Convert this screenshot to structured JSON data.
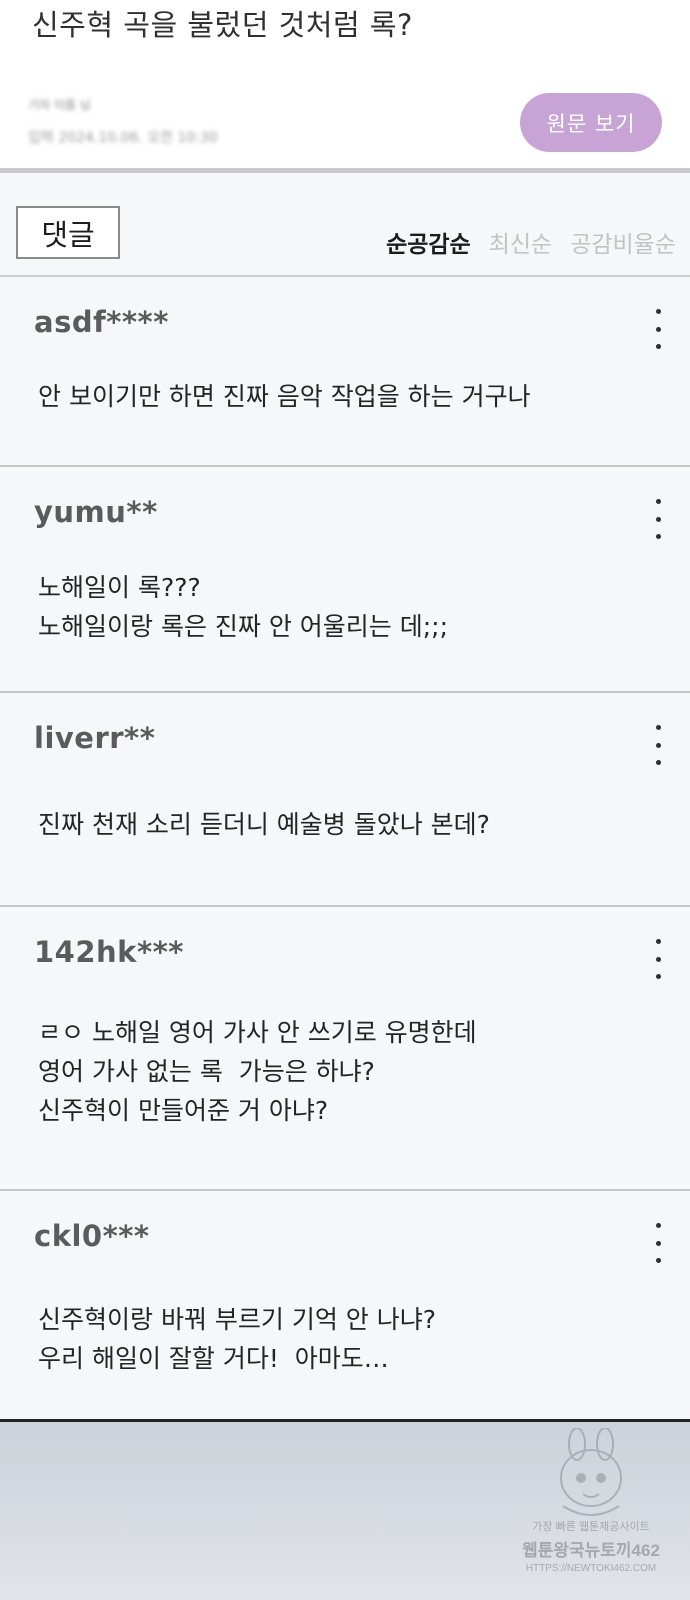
{
  "article": {
    "headline": "신주혁 곡을 불렀던 것처럼 록?",
    "reporter": "기자 이름 님",
    "date": "입력 2024.10.06. 오전 10:30",
    "original_button": "원문 보기"
  },
  "comments_header": {
    "label": "댓글",
    "sort_tabs": [
      {
        "label": "순공감순",
        "active": true
      },
      {
        "label": "최신순",
        "active": false
      },
      {
        "label": "공감비율순",
        "active": false
      }
    ]
  },
  "comments": [
    {
      "user": "asdf****",
      "lines": [
        "안 보이기만 하면 진짜 음악 작업을 하는 거구나"
      ]
    },
    {
      "user": "yumu**",
      "lines": [
        "노해일이 록???",
        "노해일이랑 록은 진짜 안 어울리는 데;;;"
      ]
    },
    {
      "user": "liverr**",
      "lines": [
        "진짜 천재 소리 듣더니 예술병 돌았나 본데?"
      ]
    },
    {
      "user": "142hk***",
      "lines": [
        "ㄹㅇ 노해일 영어 가사 안 쓰기로 유명한데",
        "영어 가사 없는 록  가능은 하냐?",
        "신주혁이 만들어준 거 아냐?"
      ]
    },
    {
      "user": "ckl0***",
      "lines": [
        "신주혁이랑 바꿔 부르기 기억 안 나냐?",
        "우리 해일이 잘할 거다!  아마도…"
      ]
    }
  ],
  "watermark": {
    "line1": "가장 빠른 웹툰제공사이트",
    "line2": "웹툰왕국뉴토끼462",
    "line3": "HTTPS://NEWTOKI462.COM"
  },
  "colors": {
    "accent_button": "#c8a3d6",
    "background": "#f6f7fb",
    "divider": "#c6c6c6"
  }
}
